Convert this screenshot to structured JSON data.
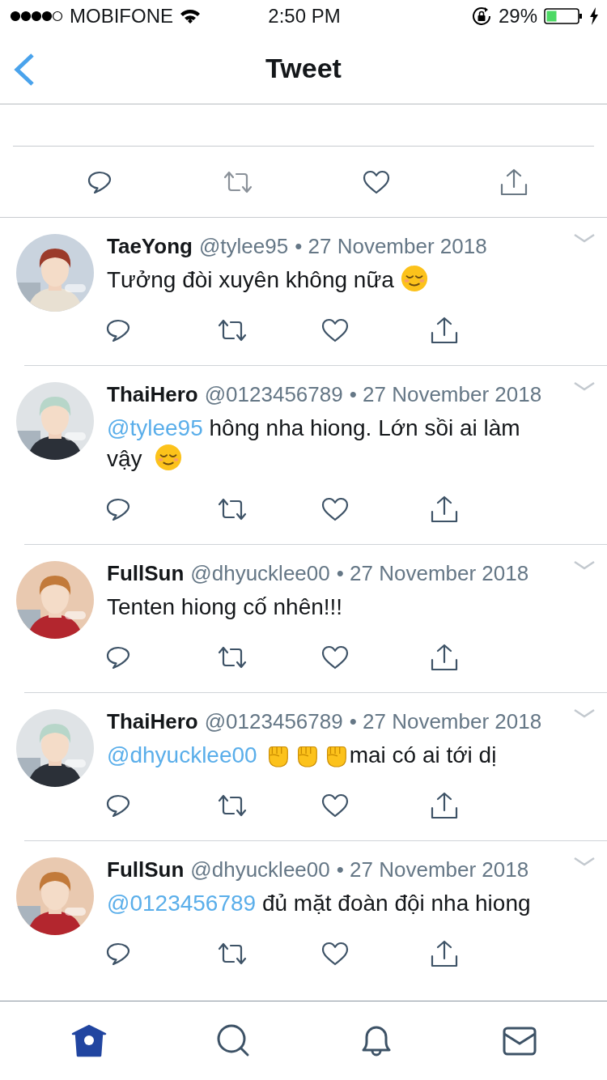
{
  "status_bar": {
    "carrier": "MOBIFONE",
    "time": "2:50 PM",
    "battery": "29%"
  },
  "nav": {
    "title": "Tweet"
  },
  "tweets": [
    {
      "name": "TaeYong",
      "handle": "@tylee95",
      "date": "• 27 November 2018",
      "text": [
        {
          "kind": "text",
          "text": "Tưởng đòi xuyên không nữa "
        },
        {
          "kind": "relieved"
        }
      ]
    },
    {
      "name": "ThaiHero",
      "handle": "@0123456789",
      "date": "• 27 November 2018",
      "text": [
        {
          "kind": "mention",
          "text": "@tylee95"
        },
        {
          "kind": "text",
          "text": " hông nha hiong. Lớn sồi ai làm vậy "
        },
        {
          "kind": "relieved"
        }
      ]
    },
    {
      "name": "FullSun",
      "handle": "@dhyucklee00",
      "date": "• 27 November 2018",
      "text": [
        {
          "kind": "text",
          "text": "Tenten hiong cố nhên!!!"
        }
      ]
    },
    {
      "name": "ThaiHero",
      "handle": "@0123456789",
      "date": "• 27 November 2018",
      "text": [
        {
          "kind": "mention",
          "text": "@dhyucklee00"
        },
        {
          "kind": "fist"
        },
        {
          "kind": "fist"
        },
        {
          "kind": "fist"
        },
        {
          "kind": "text",
          "text": "mai có ai tới dị"
        }
      ]
    },
    {
      "name": "FullSun",
      "handle": "@dhyucklee00",
      "date": "• 27 November 2018",
      "text": [
        {
          "kind": "mention",
          "text": "@0123456789"
        },
        {
          "kind": "text",
          "text": " đủ mặt đoàn đội nha hiong"
        }
      ]
    }
  ],
  "tab_bar": [
    {
      "kind": "home",
      "selected": true
    },
    {
      "kind": "search",
      "selected": false
    },
    {
      "kind": "notifications",
      "selected": false
    },
    {
      "kind": "messages",
      "selected": false
    }
  ]
}
